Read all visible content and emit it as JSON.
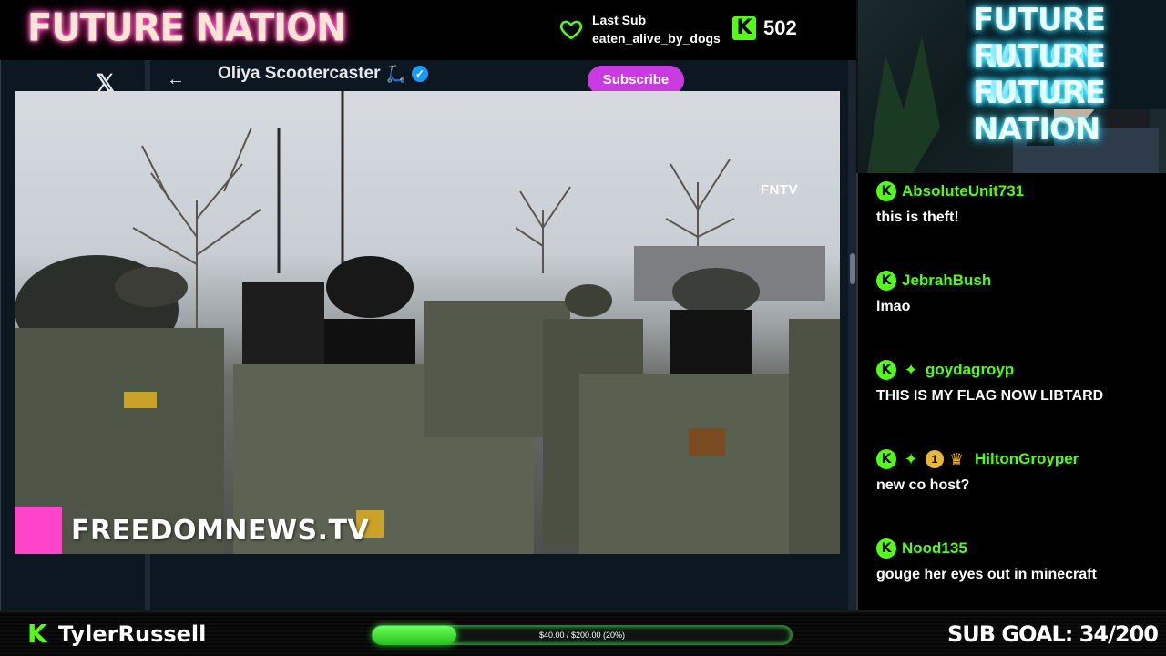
{
  "overlay": {
    "logo": "FUTURE NATION",
    "last_sub": {
      "label": "Last Sub",
      "name": "eaten_alive_by_dogs"
    },
    "kick_count": "502",
    "streamer_name": "TylerRussell",
    "sub_goal_text": "SUB GOAL: 34/200",
    "donation_goal": {
      "text": "$40.00 / $200.00 (20%)",
      "fraction": 0.2
    }
  },
  "webcam_sign": [
    "FUTURE NATION",
    "FUTURE NATION",
    "FUTURE NATION"
  ],
  "twitter": {
    "account_name": "Oliya Scootercaster",
    "subscribe_label": "Subscribe",
    "video_watermark": "FREEDOMNEWS.TV",
    "video_tag": "FNTV"
  },
  "chat": {
    "messages": [
      {
        "user": "AbsoluteUnit731",
        "text": "this is theft!",
        "badges": [
          "kick"
        ]
      },
      {
        "user": "JebrahBush",
        "text": "lmao",
        "badges": [
          "kick"
        ]
      },
      {
        "user": "goydagroyp",
        "text": "THIS IS MY FLAG NOW LIBTARD",
        "badges": [
          "kick",
          "diamond"
        ]
      },
      {
        "user": "HiltonGroyper",
        "text": "new co host?",
        "badges": [
          "kick",
          "diamond",
          "one",
          "crown"
        ],
        "one_label": "1"
      },
      {
        "user": "Nood135",
        "text": "gouge her eyes out in minecraft",
        "badges": [
          "kick"
        ]
      }
    ]
  },
  "colors": {
    "kick_green": "#53fc18",
    "subscribe": "#c93ae0",
    "verified": "#1d9bf0",
    "wm_pink": "#ff44cc"
  },
  "icons": {
    "heart": "heart-icon",
    "x": "x-logo-icon",
    "back": "back-arrow-icon",
    "verified": "verified-badge-icon"
  }
}
